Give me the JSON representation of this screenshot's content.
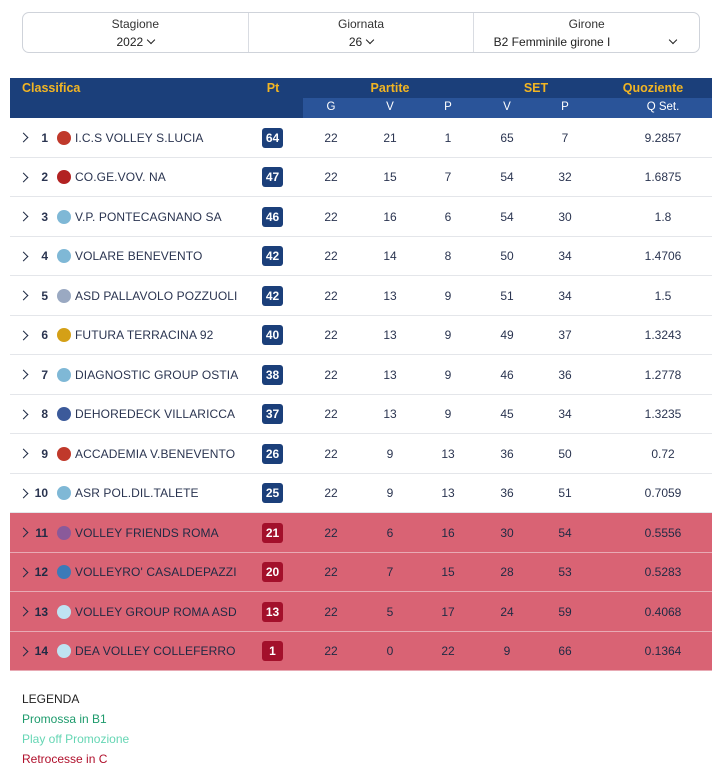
{
  "filters": [
    {
      "label": "Stagione",
      "value": "2022"
    },
    {
      "label": "Giornata",
      "value": "26"
    },
    {
      "label": "Girone",
      "value": "B2 Femminile girone I"
    }
  ],
  "table": {
    "headers": {
      "classifica": "Classifica",
      "pt": "Pt",
      "partite": "Partite",
      "set": "SET",
      "quoziente": "Quoziente"
    },
    "subheaders": {
      "g": "G",
      "v": "V",
      "p": "P",
      "sv": "V",
      "sp": "P",
      "qset": "Q Set."
    },
    "rows": [
      {
        "pos": "1",
        "team": "I.C.S VOLLEY S.LUCIA",
        "pt": "64",
        "g": "22",
        "v": "21",
        "p": "1",
        "sv": "65",
        "sp": "7",
        "q": "9.2857",
        "relegated": false,
        "logo_color": "#c0392b"
      },
      {
        "pos": "2",
        "team": "CO.GE.VOV. NA",
        "pt": "47",
        "g": "22",
        "v": "15",
        "p": "7",
        "sv": "54",
        "sp": "32",
        "q": "1.6875",
        "relegated": false,
        "logo_color": "#b22222"
      },
      {
        "pos": "3",
        "team": "V.P. PONTECAGNANO SA",
        "pt": "46",
        "g": "22",
        "v": "16",
        "p": "6",
        "sv": "54",
        "sp": "30",
        "q": "1.8",
        "relegated": false,
        "logo_color": "#7fb8d6"
      },
      {
        "pos": "4",
        "team": "VOLARE BENEVENTO",
        "pt": "42",
        "g": "22",
        "v": "14",
        "p": "8",
        "sv": "50",
        "sp": "34",
        "q": "1.4706",
        "relegated": false,
        "logo_color": "#7fb8d6"
      },
      {
        "pos": "5",
        "team": "ASD PALLAVOLO POZZUOLI",
        "pt": "42",
        "g": "22",
        "v": "13",
        "p": "9",
        "sv": "51",
        "sp": "34",
        "q": "1.5",
        "relegated": false,
        "logo_color": "#9aa9c2"
      },
      {
        "pos": "6",
        "team": "FUTURA TERRACINA 92",
        "pt": "40",
        "g": "22",
        "v": "13",
        "p": "9",
        "sv": "49",
        "sp": "37",
        "q": "1.3243",
        "relegated": false,
        "logo_color": "#d4a017"
      },
      {
        "pos": "7",
        "team": "DIAGNOSTIC GROUP OSTIA",
        "pt": "38",
        "g": "22",
        "v": "13",
        "p": "9",
        "sv": "46",
        "sp": "36",
        "q": "1.2778",
        "relegated": false,
        "logo_color": "#7fb8d6"
      },
      {
        "pos": "8",
        "team": "DEHOREDECK VILLARICCA",
        "pt": "37",
        "g": "22",
        "v": "13",
        "p": "9",
        "sv": "45",
        "sp": "34",
        "q": "1.3235",
        "relegated": false,
        "logo_color": "#3c5a9a"
      },
      {
        "pos": "9",
        "team": "ACCADEMIA V.BENEVENTO",
        "pt": "26",
        "g": "22",
        "v": "9",
        "p": "13",
        "sv": "36",
        "sp": "50",
        "q": "0.72",
        "relegated": false,
        "logo_color": "#c0392b"
      },
      {
        "pos": "10",
        "team": "ASR POL.DIL.TALETE",
        "pt": "25",
        "g": "22",
        "v": "9",
        "p": "13",
        "sv": "36",
        "sp": "51",
        "q": "0.7059",
        "relegated": false,
        "logo_color": "#7fb8d6"
      },
      {
        "pos": "11",
        "team": "VOLLEY FRIENDS ROMA",
        "pt": "21",
        "g": "22",
        "v": "6",
        "p": "16",
        "sv": "30",
        "sp": "54",
        "q": "0.5556",
        "relegated": true,
        "logo_color": "#8a5a9a"
      },
      {
        "pos": "12",
        "team": "VOLLEYRO' CASALDEPAZZI",
        "pt": "20",
        "g": "22",
        "v": "7",
        "p": "15",
        "sv": "28",
        "sp": "53",
        "q": "0.5283",
        "relegated": true,
        "logo_color": "#3c7ab8"
      },
      {
        "pos": "13",
        "team": "VOLLEY GROUP ROMA ASD",
        "pt": "13",
        "g": "22",
        "v": "5",
        "p": "17",
        "sv": "24",
        "sp": "59",
        "q": "0.4068",
        "relegated": true,
        "logo_color": "#bfe3f2"
      },
      {
        "pos": "14",
        "team": "DEA VOLLEY COLLEFERRO",
        "pt": "1",
        "g": "22",
        "v": "0",
        "p": "22",
        "sv": "9",
        "sp": "66",
        "q": "0.1364",
        "relegated": true,
        "logo_color": "#bfe3f2"
      }
    ]
  },
  "legend": {
    "title": "LEGENDA",
    "promossa": "Promossa in B1",
    "playoff": "Play off Promozione",
    "retrocesse": "Retrocesse in C"
  }
}
